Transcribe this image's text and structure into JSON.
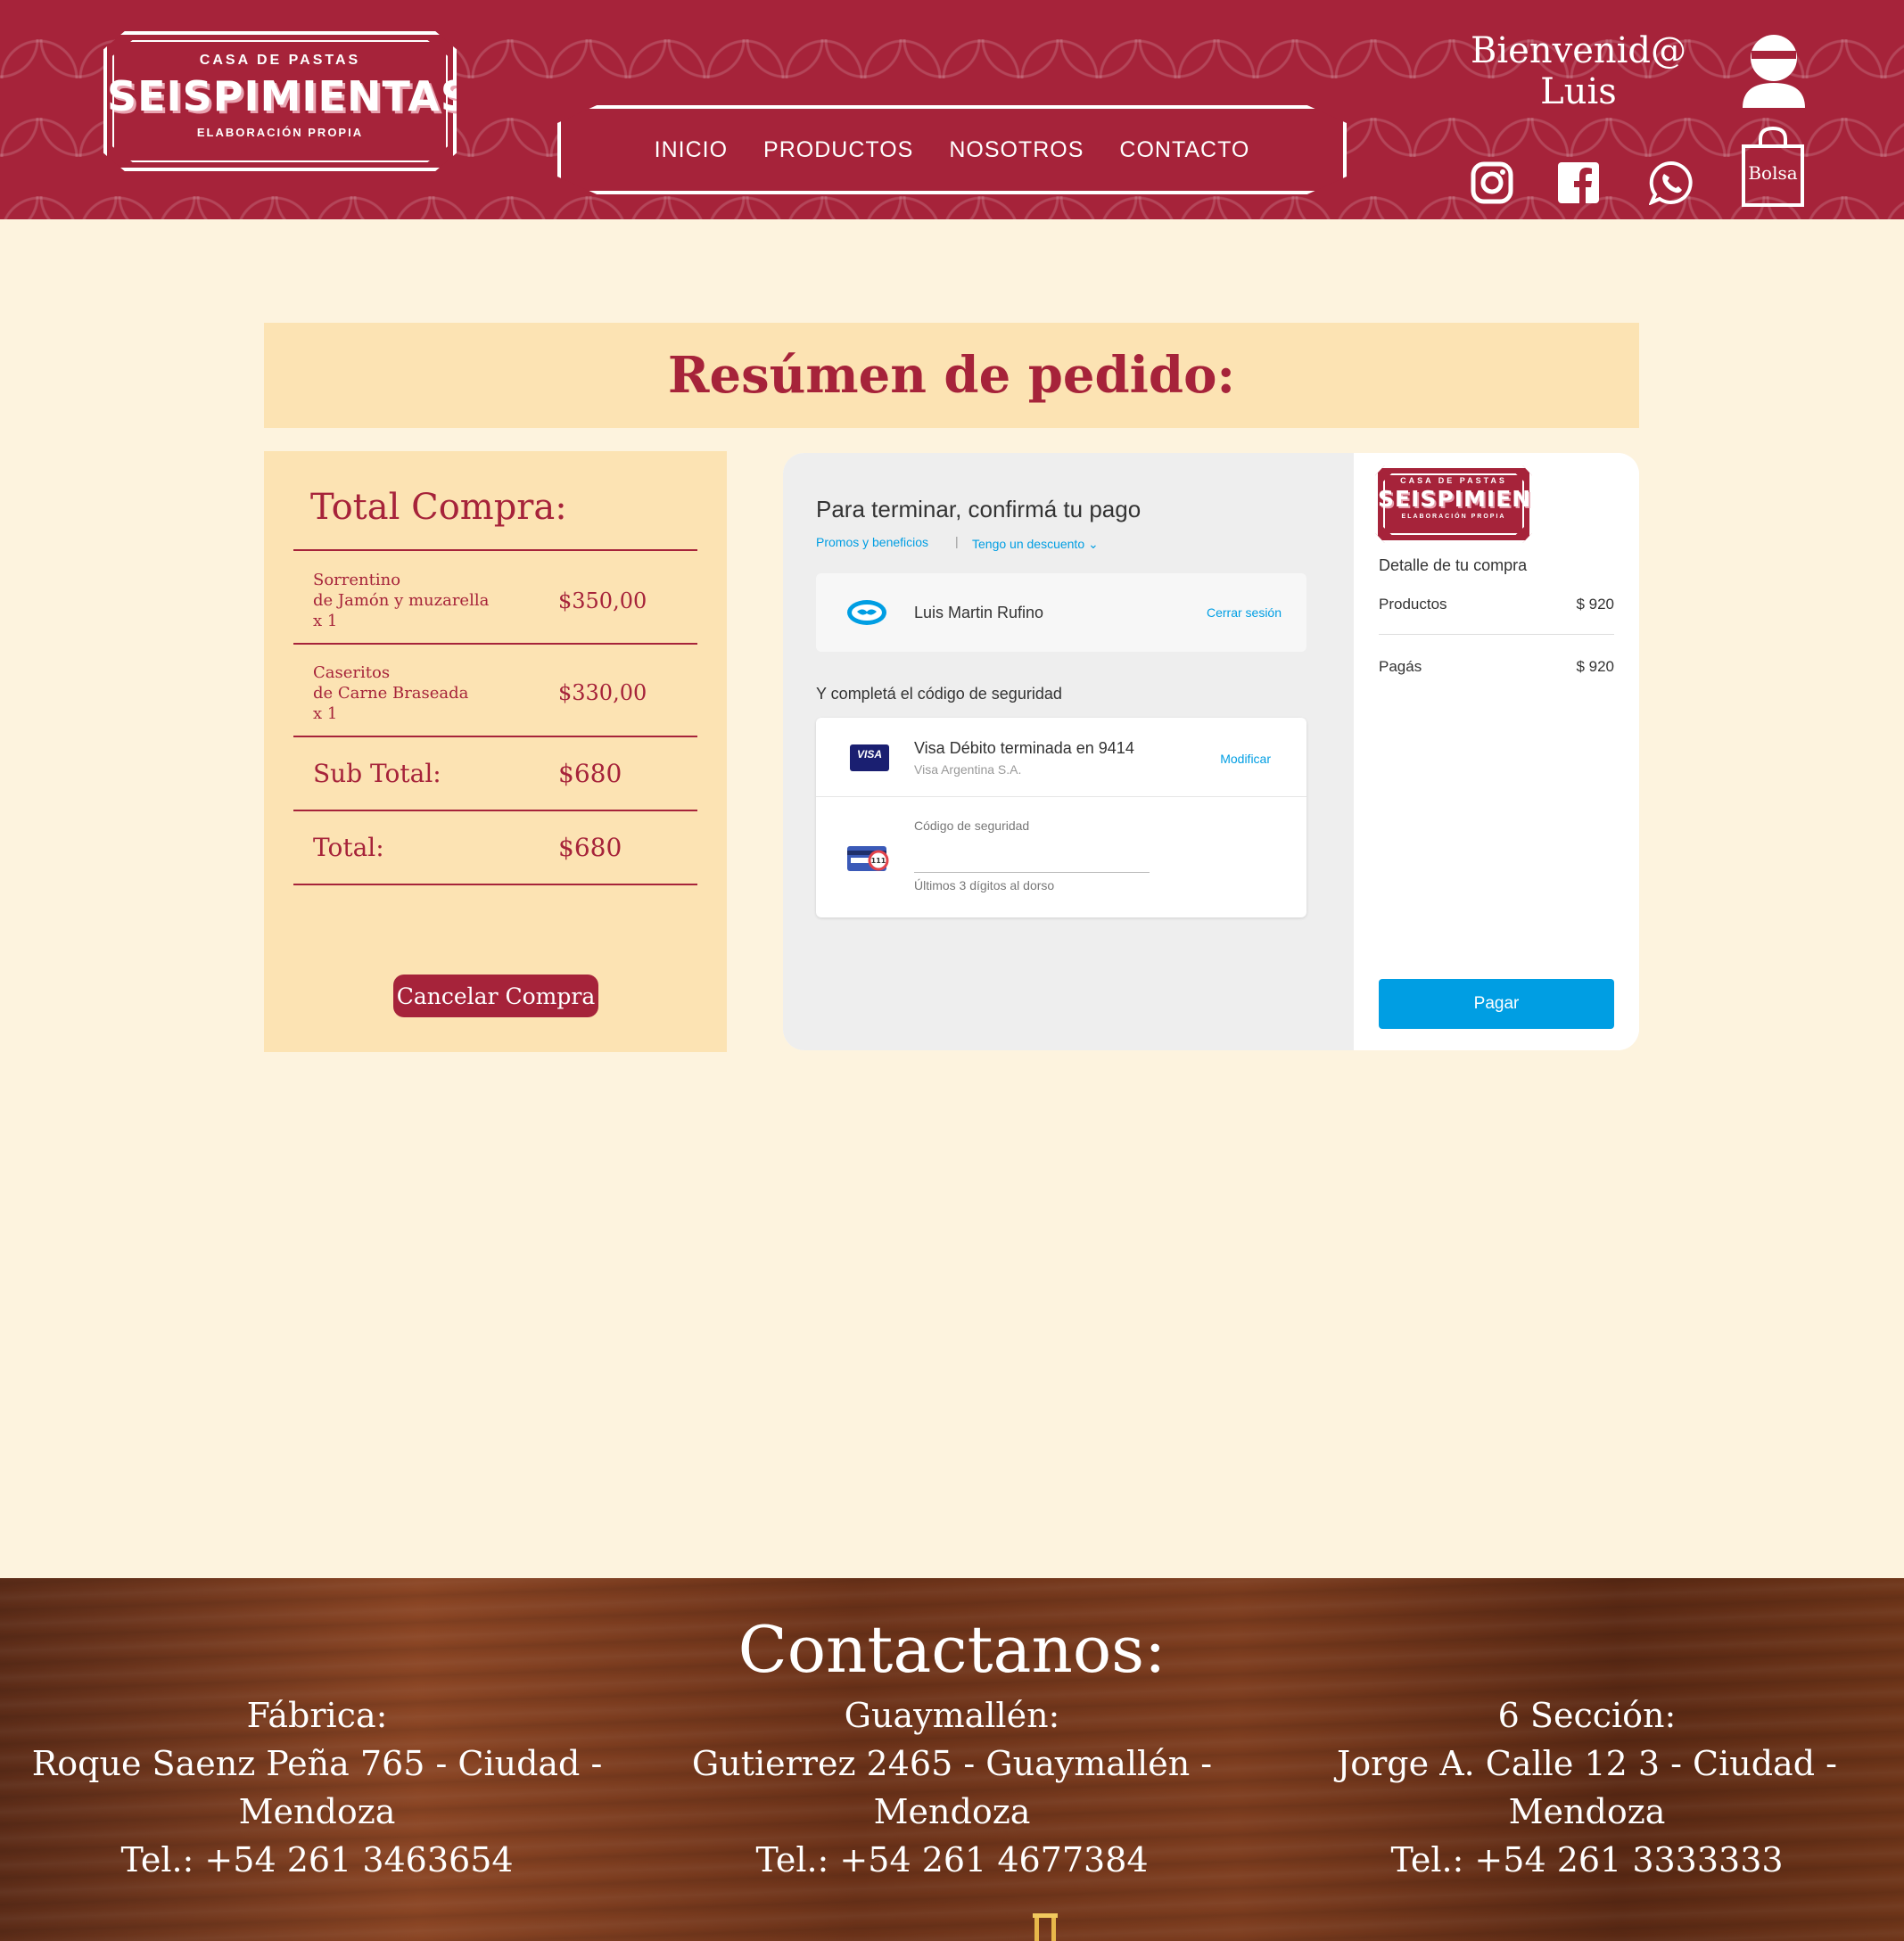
{
  "brand": {
    "top_line": "CASA DE PASTAS",
    "name": "SEISPIMIENTAS",
    "bottom_line": "ELABORACIÓN PROPIA"
  },
  "nav": {
    "items": [
      {
        "label": "INICIO"
      },
      {
        "label": "PRODUCTOS"
      },
      {
        "label": "NOSOTROS"
      },
      {
        "label": "CONTACTO"
      }
    ]
  },
  "user": {
    "greeting": "Bienvenid@",
    "name": "Luis"
  },
  "bag": {
    "label": "Bolsa"
  },
  "icons": [
    "instagram-icon",
    "facebook-icon",
    "whatsapp-icon",
    "user-icon",
    "bag-icon"
  ],
  "colors": {
    "brand": "#a6233a",
    "panel": "#fce3b3",
    "page_background": "#fdf3de",
    "pay_blue": "#009ee3"
  },
  "summary": {
    "title": "Resúmen de pedido:"
  },
  "order": {
    "title": "Total Compra:",
    "items": [
      {
        "line1": "Sorrentino",
        "line2": "de Jamón y muzarella",
        "qty": "x 1",
        "price": "$350,00"
      },
      {
        "line1": "Caseritos",
        "line2": "de Carne Braseada",
        "qty": "x 1",
        "price": "$330,00"
      }
    ],
    "subtotal_label": "Sub Total:",
    "subtotal_value": "$680",
    "total_label": "Total:",
    "total_value": "$680",
    "cancel_label": "Cancelar Compra"
  },
  "checkout": {
    "title": "Para terminar, confirmá tu pago",
    "promos_link": "Promos y beneficios",
    "separator": "|",
    "discount_link": "Tengo un descuento ⌄",
    "account_name": "Luis Martin Rufino",
    "logout_link": "Cerrar sesión",
    "security_heading": "Y completá el código de seguridad",
    "card_brand": "VISA",
    "card_title": "Visa Débito terminada en 9414",
    "card_subtitle": "Visa Argentina S.A.",
    "modify_link": "Modificar",
    "cvv_label": "Código de seguridad",
    "cvv_help": "Últimos 3 dígitos al dorso",
    "detail_title": "Detalle de tu compra",
    "products_label": "Productos",
    "products_value": "$ 920",
    "paid_label": "Pagás",
    "paid_value": "$ 920",
    "pay_button": "Pagar"
  },
  "footer": {
    "title": "Contactanos:",
    "branches": [
      {
        "name": "Fábrica:",
        "address": "Roque Saenz Peña 765 - Ciudad - Mendoza",
        "phone": "Tel.: +54 261 3463654"
      },
      {
        "name": "Guaymallén:",
        "address": "Gutierrez 2465 - Guaymallén - Mendoza",
        "phone": "Tel.: +54 261 4677384"
      },
      {
        "name": "6 Sección:",
        "address": "Jorge A. Calle 12 3 - Ciudad - Mendoza",
        "phone": "Tel.: +54 261 3333333"
      }
    ]
  }
}
